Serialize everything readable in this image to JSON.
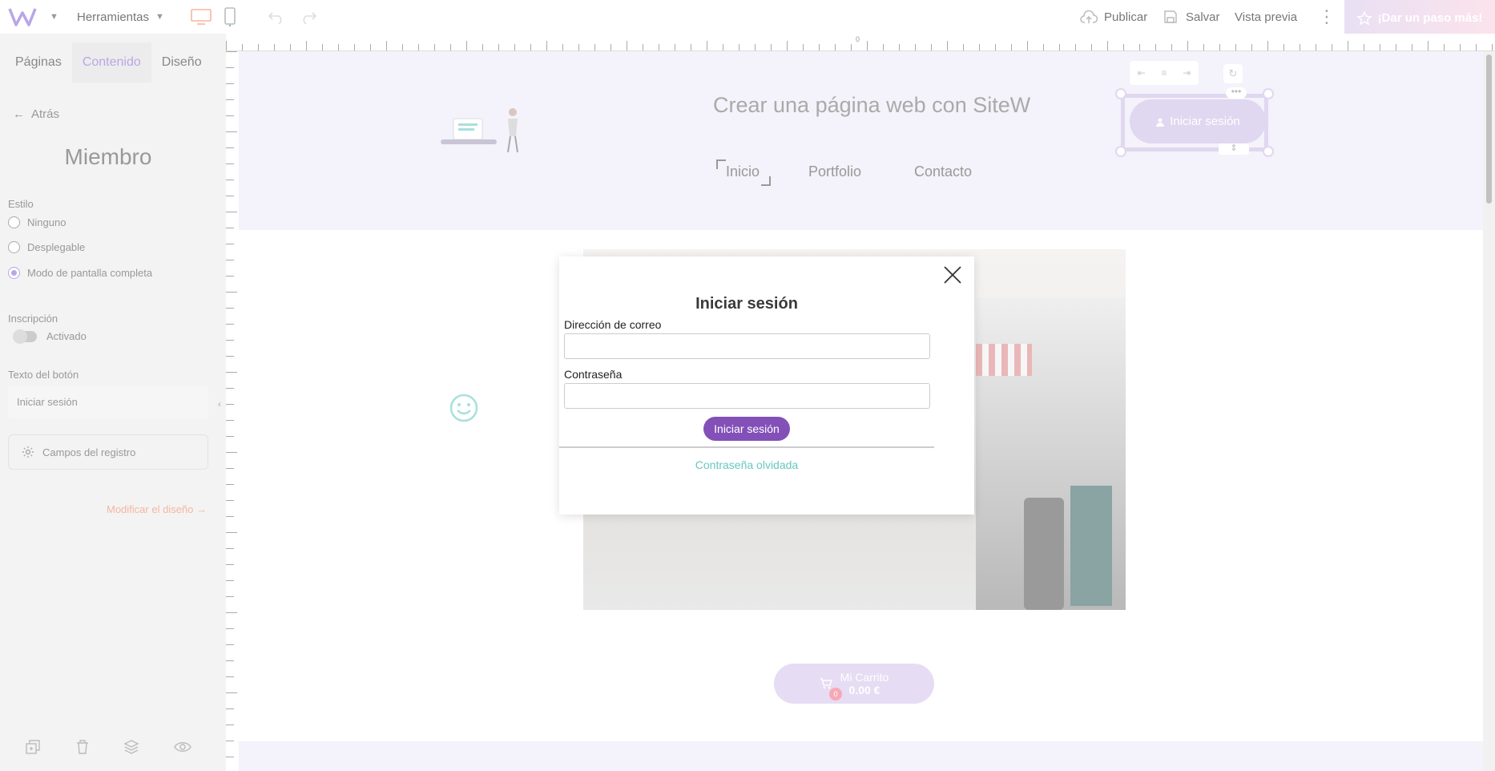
{
  "toolbar": {
    "tools_label": "Herramientas",
    "publish_label": "Publicar",
    "save_label": "Salvar",
    "preview_label": "Vista previa",
    "cta_label": "¡Dar un paso más!"
  },
  "left_panel": {
    "tabs": [
      {
        "label": "Páginas"
      },
      {
        "label": "Contenido"
      },
      {
        "label": "Diseño"
      }
    ],
    "back_label": "Atrás",
    "title": "Miembro",
    "style_label": "Estilo",
    "style_options": [
      {
        "label": "Ninguno"
      },
      {
        "label": "Desplegable"
      },
      {
        "label": "Modo de pantalla completa"
      }
    ],
    "signup_label": "Inscripción",
    "signup_toggle_label": "Activado",
    "button_text_label": "Texto del botón",
    "button_text_value": "Iniciar sesión",
    "register_fields_label": "Campos del registro",
    "modify_design_label": "Modificar el diseño →"
  },
  "ruler": {
    "zero": "0"
  },
  "site": {
    "title": "Crear una página web con SiteW",
    "nav": [
      {
        "label": "Inicio"
      },
      {
        "label": "Portfolio"
      },
      {
        "label": "Contacto"
      }
    ],
    "login_button": "Iniciar sesión",
    "cart_label": "Mi Carrito",
    "cart_amount": "0.00 €",
    "cart_count": "0"
  },
  "modal": {
    "title": "Iniciar sesión",
    "email_label": "Dirección de correo",
    "password_label": "Contraseña",
    "submit_label": "Iniciar sesión",
    "forgot_label": "Contraseña olvidada"
  },
  "colors": {
    "accent": "#8350b8",
    "link": "#67c8c0",
    "selection": "#b9a6e8"
  }
}
